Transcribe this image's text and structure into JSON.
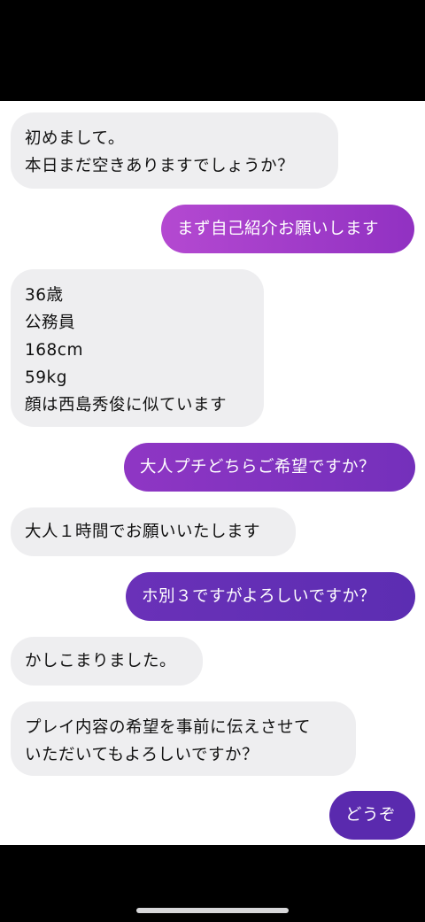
{
  "colors": {
    "incoming_bubble": "#eeeef0",
    "outgoing_gradient_start": "#b449d1",
    "outgoing_gradient_end": "#5b2bb2"
  },
  "messages": [
    {
      "direction": "incoming",
      "text": "初めまして。\n本日まだ空きありますでしょうか？"
    },
    {
      "direction": "outgoing",
      "text": "まず自己紹介お願いします"
    },
    {
      "direction": "incoming",
      "text": "36歳\n公務員\n168cm\n59kg\n顔は西島秀俊に似ています"
    },
    {
      "direction": "outgoing",
      "text": "大人プチどちらご希望ですか？"
    },
    {
      "direction": "incoming",
      "text": "大人１時間でお願いいたします"
    },
    {
      "direction": "outgoing",
      "text": "ホ別３ですがよろしいですか？"
    },
    {
      "direction": "incoming",
      "text": "かしこまりました。"
    },
    {
      "direction": "incoming",
      "text": "プレイ内容の希望を事前に伝えさせて\nいただいてもよろしいですか？"
    },
    {
      "direction": "outgoing",
      "text": "どうぞ"
    }
  ]
}
